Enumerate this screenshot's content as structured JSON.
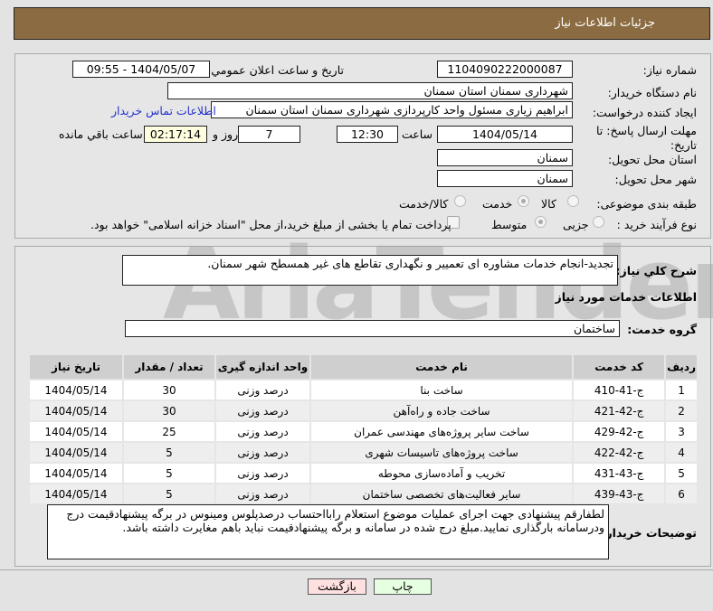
{
  "header": {
    "title": "جزئیات اطلاعات نیاز"
  },
  "watermark": "AriaTender.net",
  "form": {
    "need_number_label": "شماره نیاز:",
    "need_number": "1104090222000087",
    "announce_label": "تاریخ و ساعت اعلان عمومي:",
    "announce_value": "1404/05/07 - 09:55",
    "buyer_org_label": "نام دستگاه خریدار:",
    "buyer_org": "شهرداری سمنان استان سمنان",
    "creator_label": "ایجاد کننده درخواست:",
    "creator": "ابراهیم زیاری مسئول واحد کارپردازی شهرداری سمنان استان سمنان",
    "contact_link": "اطلاعات تماس خریدار",
    "deadline_label": "مهلت ارسال پاسخ: تا تاریخ:",
    "deadline_date": "1404/05/14",
    "time_label": "ساعت",
    "deadline_time": "12:30",
    "days": "7",
    "days_label": "روز و",
    "remaining": "02:17:14",
    "remaining_label": "ساعت باقي مانده",
    "province_label": "استان محل تحویل:",
    "province": "سمنان",
    "city_label": "شهر محل تحویل:",
    "city": "سمنان",
    "category_label": "طبقه بندی موضوعی:",
    "category_options": [
      "کالا",
      "خدمت",
      "کالا/خدمت"
    ],
    "process_label": "نوع فرآیند خرید :",
    "process_options": [
      "جزیی",
      "متوسط"
    ],
    "payment_note": "پرداخت تمام یا بخشی از مبلغ خرید،از محل \"اسناد خزانه اسلامی\" خواهد بود."
  },
  "details": {
    "desc_label": "شرح کلي نیاز:",
    "desc": "تجدید-انجام خدمات مشاوره ای تعمییر و نگهداری تقاطع های غیر همسطح شهر سمنان.",
    "services_title": "اطلاعات خدمات مورد نیاز",
    "group_label": "گروه خدمت:",
    "group": "ساختمان",
    "table": {
      "headers": [
        "ردیف",
        "کد خدمت",
        "نام خدمت",
        "واحد اندازه گیری",
        "تعداد / مقدار",
        "تاریخ نیاز"
      ],
      "rows": [
        [
          "1",
          "ج-41-410",
          "ساخت بنا",
          "درصد وزنی",
          "30",
          "1404/05/14"
        ],
        [
          "2",
          "ج-42-421",
          "ساخت جاده و راه‌آهن",
          "درصد وزنی",
          "30",
          "1404/05/14"
        ],
        [
          "3",
          "ج-42-429",
          "ساخت سایر پروژه‌های مهندسی عمران",
          "درصد وزنی",
          "25",
          "1404/05/14"
        ],
        [
          "4",
          "ج-42-422",
          "ساخت پروژه‌های تاسیسات شهری",
          "درصد وزنی",
          "5",
          "1404/05/14"
        ],
        [
          "5",
          "ج-43-431",
          "تخریب و آماده‌سازی محوطه",
          "درصد وزنی",
          "5",
          "1404/05/14"
        ],
        [
          "6",
          "ج-43-439",
          "سایر فعالیت‌های تخصصی ساختمان",
          "درصد وزنی",
          "5",
          "1404/05/14"
        ]
      ]
    },
    "notes_label": "توضیحات خریدار:",
    "notes": "لطفارقم پیشنهادی جهت اجرای عملیات موضوع استعلام رابااحتساب درصدپلوس ومینوس در برگه پیشنهادقیمت درج ودرسامانه بارگذاری نمایید.مبلغ درج شده در سامانه و برگه پیشنهادقیمت نباید باهم مغایرت داشته باشد."
  },
  "buttons": {
    "print": "چاپ",
    "back": "بازگشت"
  }
}
